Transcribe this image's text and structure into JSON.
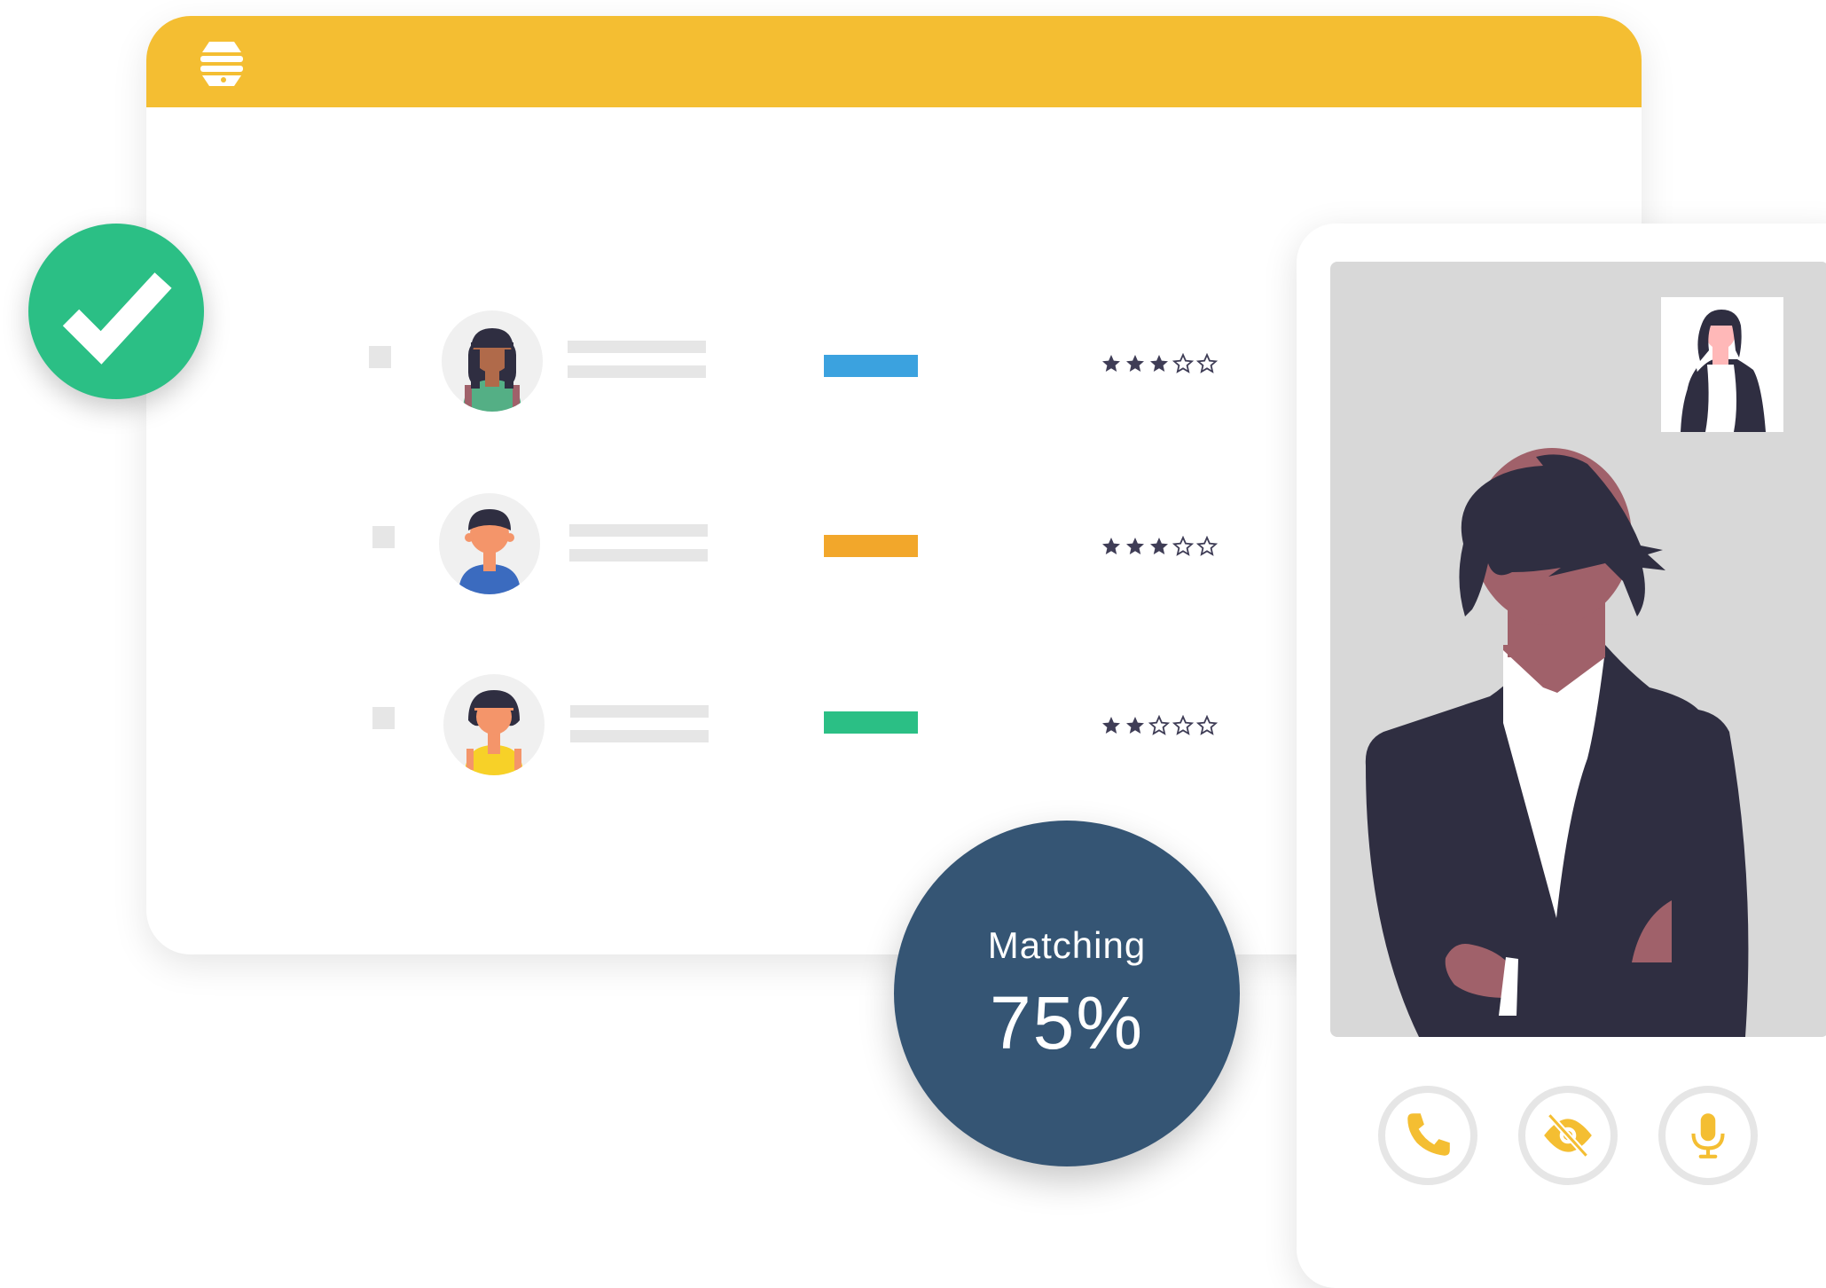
{
  "colors": {
    "brand_yellow": "#F4BE32",
    "success_green": "#2BBF85",
    "navy": "#355574",
    "bar_blue": "#3BA2DF",
    "bar_orange": "#F2A72B",
    "bar_green": "#2BBF85",
    "star_dark": "#3F3D56"
  },
  "app": {
    "logo_icon": "hive-logo-icon",
    "verified_icon": "checkmark-icon"
  },
  "candidates": [
    {
      "avatar": "woman-braids-avatar",
      "status_color": "#3BA2DF",
      "rating": 3,
      "rating_max": 5
    },
    {
      "avatar": "man-avatar",
      "status_color": "#F2A72B",
      "rating": 3,
      "rating_max": 5
    },
    {
      "avatar": "woman-bob-avatar",
      "status_color": "#2BBF85",
      "rating": 2,
      "rating_max": 5
    }
  ],
  "match": {
    "label": "Matching",
    "value": "75%",
    "percent": 75
  },
  "video_call": {
    "controls": [
      "phone-icon",
      "camera-off-icon",
      "microphone-icon"
    ]
  }
}
